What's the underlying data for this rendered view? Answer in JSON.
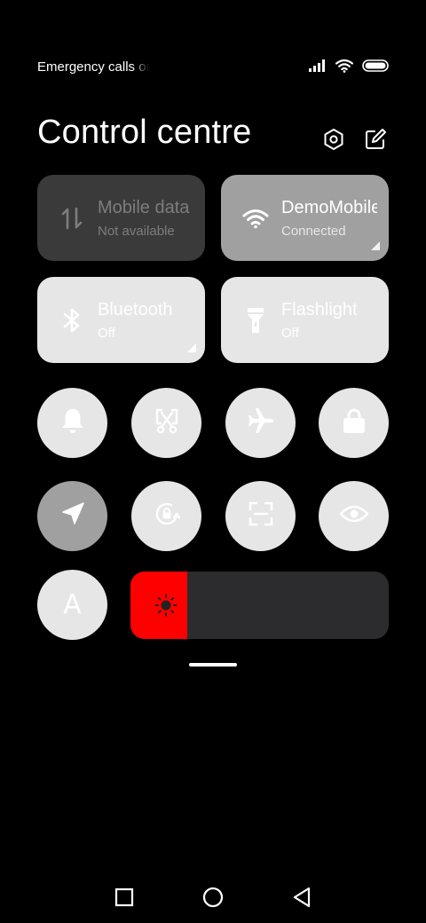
{
  "status_bar": {
    "text": "Emergency calls only",
    "icons": [
      "signal-icon",
      "wifi-icon",
      "battery-icon"
    ]
  },
  "header": {
    "title": "Control centre",
    "settings_icon": "settings-icon",
    "edit_icon": "edit-icon"
  },
  "tiles": [
    {
      "title": "Mobile data",
      "subtitle": "Not available",
      "icon": "data-transfer-icon",
      "state": "disabled"
    },
    {
      "title": "DemoMobile",
      "subtitle": "Connected",
      "icon": "wifi-icon",
      "state": "on"
    },
    {
      "title": "Bluetooth",
      "subtitle": "Off",
      "icon": "bluetooth-icon",
      "state": "off"
    },
    {
      "title": "Flashlight",
      "subtitle": "Off",
      "icon": "flashlight-icon",
      "state": "off"
    }
  ],
  "round_buttons": [
    {
      "icon": "bell-icon",
      "state": "off"
    },
    {
      "icon": "screenshot-icon",
      "state": "off"
    },
    {
      "icon": "airplane-icon",
      "state": "off"
    },
    {
      "icon": "lock-icon",
      "state": "off"
    },
    {
      "icon": "location-icon",
      "state": "on"
    },
    {
      "icon": "rotation-lock-icon",
      "state": "off"
    },
    {
      "icon": "scanner-icon",
      "state": "off"
    },
    {
      "icon": "eye-icon",
      "state": "off"
    },
    {
      "icon": "auto-brightness-icon",
      "label": "A",
      "state": "off"
    }
  ],
  "brightness": {
    "level": 0.22,
    "fill_color": "#ff0000",
    "icon": "brightness-icon"
  },
  "nav": {
    "items": [
      "recents-icon",
      "home-icon",
      "back-icon"
    ]
  },
  "colors": {
    "background": "#000000",
    "tile_on": "#a0a0a0",
    "tile_off": "#e6e6e6",
    "tile_disabled": "#3a3a3a",
    "slider_track": "#2c2c2e",
    "slider_fill": "#ff0000"
  }
}
